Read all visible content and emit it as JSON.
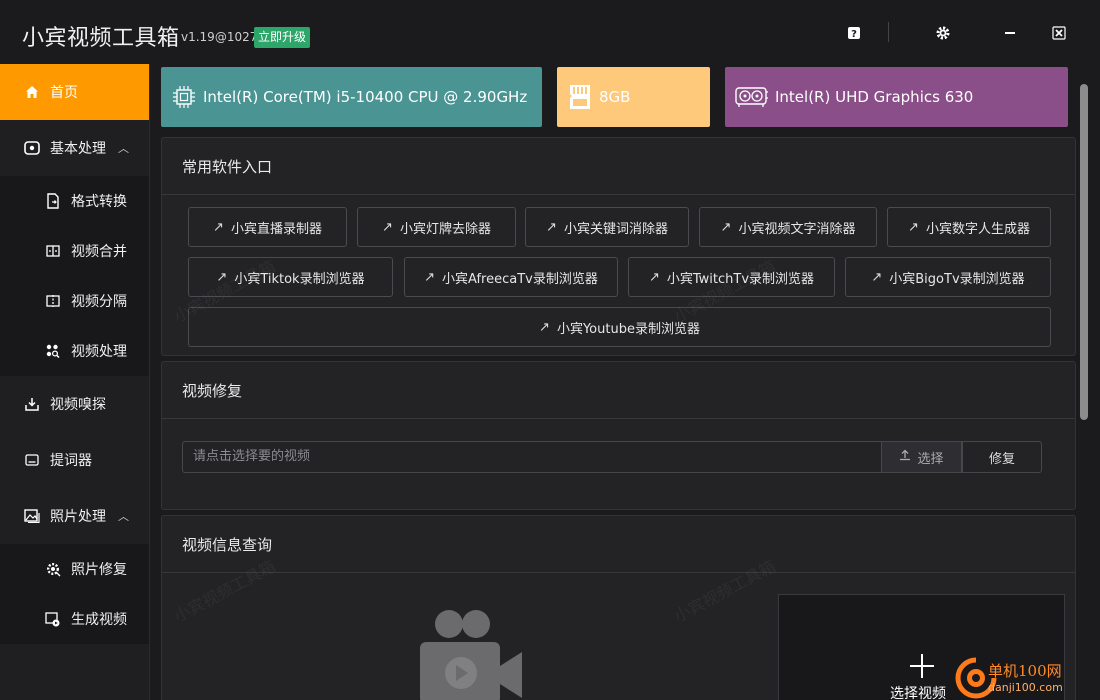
{
  "app": {
    "title": "小宾视频工具箱",
    "version": "v1.19@1027",
    "upgrade_label": "立即升级"
  },
  "window_controls": [
    "help-icon",
    "gear-icon",
    "minimize-icon",
    "close-icon"
  ],
  "sidebar": {
    "home": "首页",
    "basic": "基本处理",
    "basic_items": [
      "格式转换",
      "视频合并",
      "视频分隔",
      "视频处理"
    ],
    "sniff": "视频嗅探",
    "prompter": "提词器",
    "photo": "照片处理",
    "photo_items": [
      "照片修复",
      "生成视频"
    ]
  },
  "hardware": {
    "cpu": "Intel(R) Core(TM) i5-10400 CPU @ 2.90GHz",
    "memory": "8GB",
    "gpu": "Intel(R) UHD Graphics 630",
    "colors": {
      "cpu": "#4a9494",
      "memory": "#ffc97c",
      "gpu": "#8a4f88"
    }
  },
  "common_software": {
    "title": "常用软件入口",
    "row1": [
      "小宾直播录制器",
      "小宾灯牌去除器",
      "小宾关键词消除器",
      "小宾视频文字消除器",
      "小宾数字人生成器"
    ],
    "row2": [
      "小宾Tiktok录制浏览器",
      "小宾AfreecaTv录制浏览器",
      "小宾TwitchTv录制浏览器",
      "小宾BigoTv录制浏览器"
    ],
    "row3": "小宾Youtube录制浏览器"
  },
  "video_repair": {
    "title": "视频修复",
    "placeholder": "请点击选择要的视频",
    "choose_label": "选择",
    "repair_label": "修复"
  },
  "video_info": {
    "title": "视频信息查询",
    "select_video": "选择视频"
  },
  "watermark_text": "小宾视频工具箱",
  "site_logo": {
    "name": "单机100网",
    "url_text": "danji100.com"
  },
  "accent_color": "#ff9900"
}
